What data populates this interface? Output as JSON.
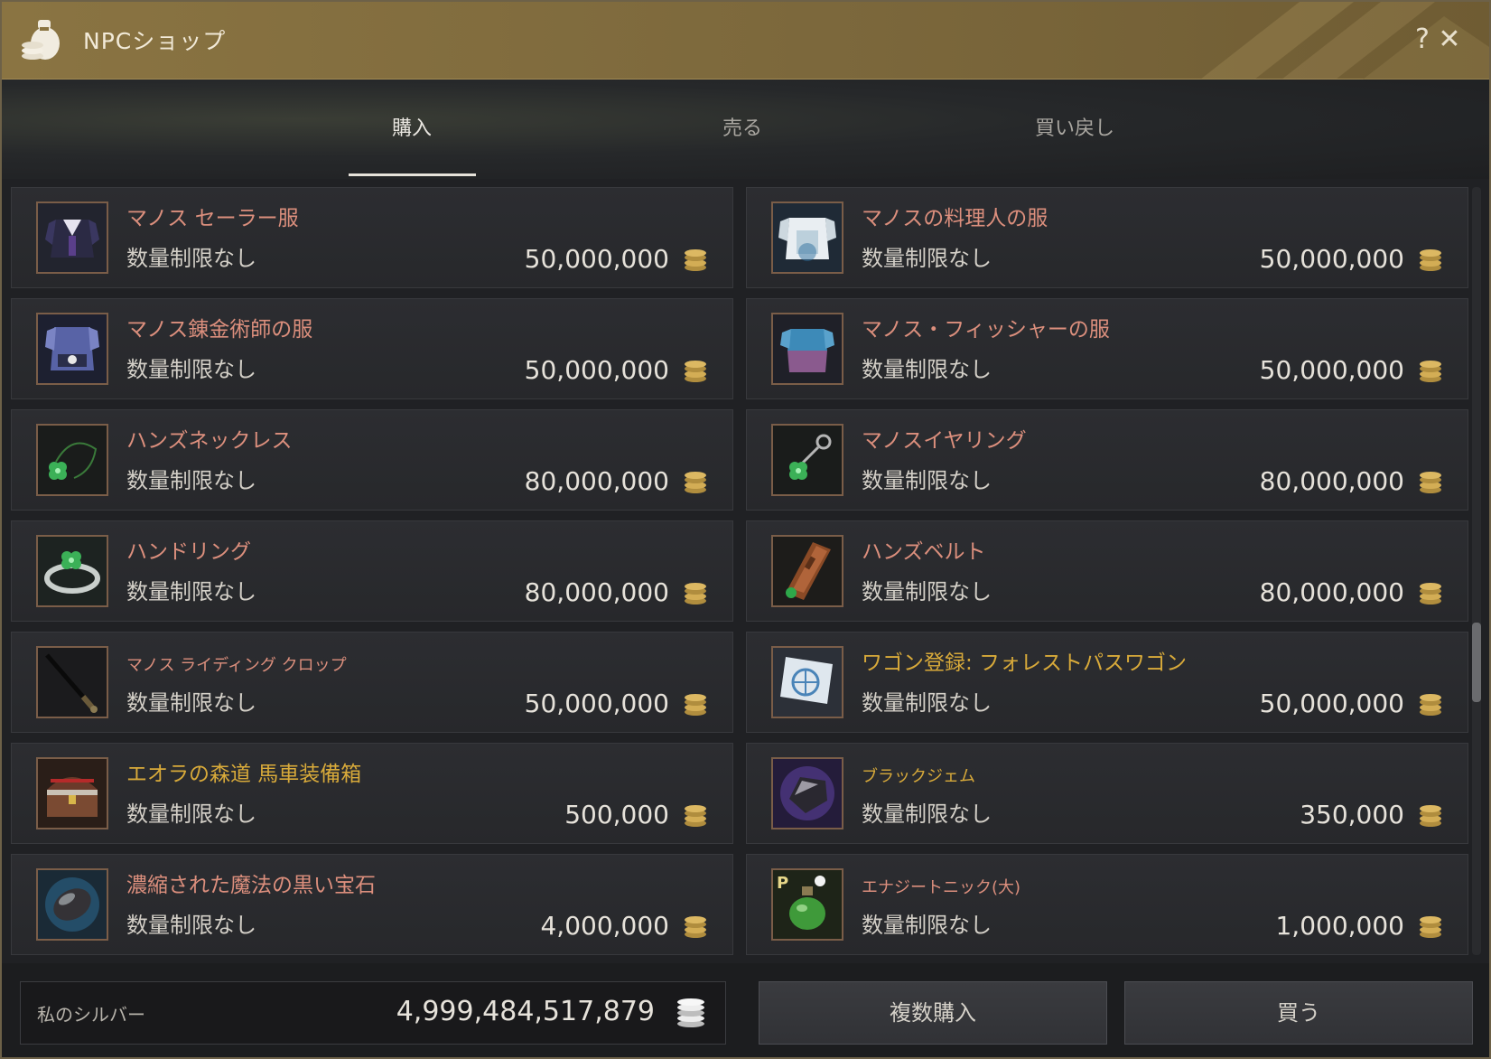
{
  "window": {
    "title": "NPCショップ",
    "help_label": "?",
    "close_label": "✕"
  },
  "tabs": [
    {
      "label": "購入",
      "active": true
    },
    {
      "label": "売る",
      "active": false
    },
    {
      "label": "買い戻し",
      "active": false
    }
  ],
  "items": [
    {
      "name": "マノス セーラー服",
      "limit": "数量制限なし",
      "price": "50,000,000",
      "icon": "sailor-outfit-icon"
    },
    {
      "name": "マノスの料理人の服",
      "limit": "数量制限なし",
      "price": "50,000,000",
      "icon": "cook-outfit-icon"
    },
    {
      "name": "マノス錬金術師の服",
      "limit": "数量制限なし",
      "price": "50,000,000",
      "icon": "alchemist-outfit-icon"
    },
    {
      "name": "マノス・フィッシャーの服",
      "limit": "数量制限なし",
      "price": "50,000,000",
      "icon": "fisher-outfit-icon"
    },
    {
      "name": "ハンズネックレス",
      "limit": "数量制限なし",
      "price": "80,000,000",
      "icon": "necklace-icon"
    },
    {
      "name": "マノスイヤリング",
      "limit": "数量制限なし",
      "price": "80,000,000",
      "icon": "earring-icon"
    },
    {
      "name": "ハンドリング",
      "limit": "数量制限なし",
      "price": "80,000,000",
      "icon": "ring-icon"
    },
    {
      "name": "ハンズベルト",
      "limit": "数量制限なし",
      "price": "80,000,000",
      "icon": "belt-icon"
    },
    {
      "name": "マノス ライディング クロップ",
      "limit": "数量制限なし",
      "price": "50,000,000",
      "icon": "riding-crop-icon"
    },
    {
      "name": "ワゴン登録: フォレストパスワゴン",
      "limit": "数量制限なし",
      "price": "50,000,000",
      "icon": "wagon-license-icon"
    },
    {
      "name": "エオラの森道 馬車装備箱",
      "limit": "数量制限なし",
      "price": "500,000",
      "icon": "equipment-chest-icon"
    },
    {
      "name": "ブラックジェム",
      "limit": "数量制限なし",
      "price": "350,000",
      "icon": "black-gem-icon"
    },
    {
      "name": "濃縮された魔法の黒い宝石",
      "limit": "数量制限なし",
      "price": "4,000,000",
      "icon": "concentrated-black-stone-icon"
    },
    {
      "name": "エナジートニック(大)",
      "limit": "数量制限なし",
      "price": "1,000,000",
      "icon": "energy-tonic-icon"
    }
  ],
  "footer": {
    "silver_label": "私のシルバー",
    "silver_value": "4,999,484,517,879",
    "bulk_buy_label": "複数購入",
    "buy_label": "買う"
  },
  "colors": {
    "name_salmon": "#dc8f7d",
    "name_gold": "#d8aa3a",
    "titlebar": "#8a7442",
    "coin": "#c9a44c"
  }
}
